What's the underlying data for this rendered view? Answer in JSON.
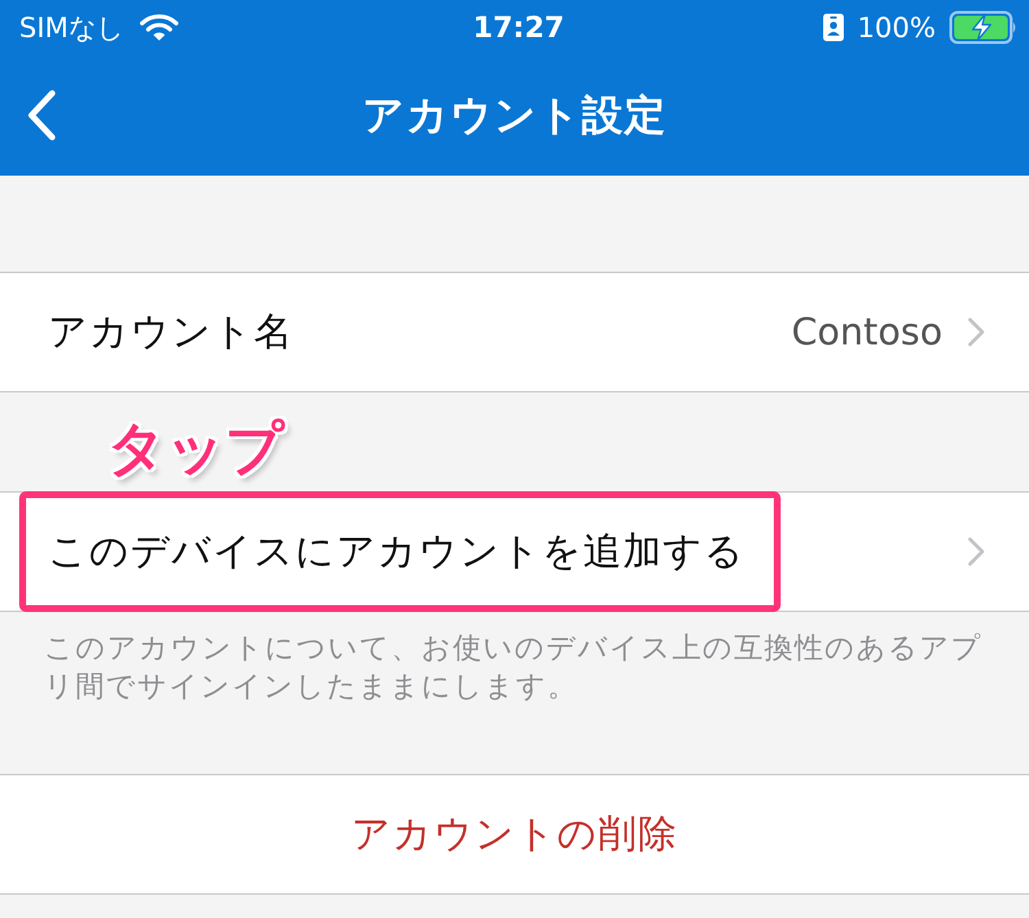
{
  "status_bar": {
    "carrier": "SIMなし",
    "time": "17:27",
    "battery": "100%"
  },
  "nav_bar": {
    "title": "アカウント設定"
  },
  "groups": [
    {
      "rows": [
        {
          "kind": "value",
          "label": "アカウント名",
          "value": "Contoso",
          "highlighted": false
        }
      ]
    },
    {
      "callout": "タップ",
      "rows": [
        {
          "kind": "link",
          "label": "このデバイスにアカウントを追加する",
          "highlighted": true
        }
      ],
      "footer": "このアカウントについて、お使いのデバイス上の互換性のあるアプリ間でサインインしたままにします。"
    },
    {
      "rows": [
        {
          "kind": "destructive",
          "label": "アカウントの削除",
          "highlighted": false
        }
      ]
    }
  ]
}
